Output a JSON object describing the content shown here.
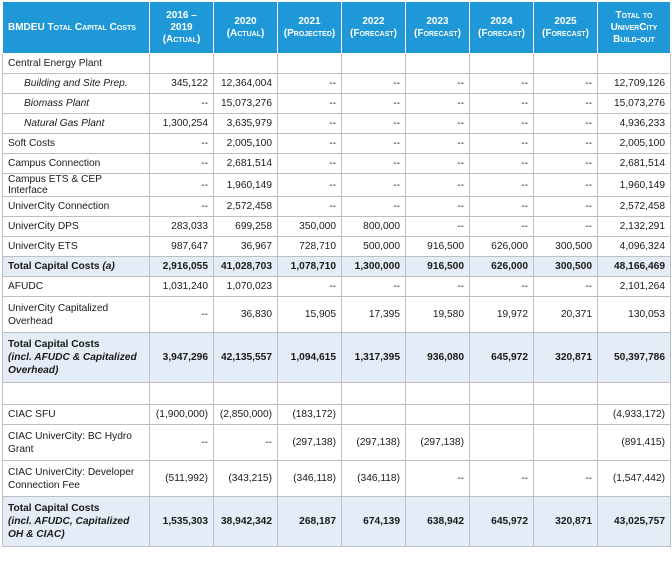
{
  "header": {
    "title": "BMDEU Total Capital Costs",
    "columns": [
      {
        "line1": "2016 –",
        "line2": "2019",
        "line3": "(Actual)"
      },
      {
        "line1": "2020",
        "line2": "(Actual)",
        "line3": ""
      },
      {
        "line1": "2021",
        "line2": "(Projected)",
        "line3": ""
      },
      {
        "line1": "2022",
        "line2": "(Forecast)",
        "line3": ""
      },
      {
        "line1": "2023",
        "line2": "(Forecast)",
        "line3": ""
      },
      {
        "line1": "2024",
        "line2": "(Forecast)",
        "line3": ""
      },
      {
        "line1": "2025",
        "line2": "(Forecast)",
        "line3": ""
      },
      {
        "line1": "Total to",
        "line2": "UniverCity",
        "line3": "Build-out"
      }
    ]
  },
  "rows": [
    {
      "label": "Central Energy Plant",
      "values": [
        "",
        "",
        "",
        "",
        "",
        "",
        "",
        ""
      ]
    },
    {
      "label": "Building and Site Prep.",
      "values": [
        "345,122",
        "12,364,004",
        "--",
        "--",
        "--",
        "--",
        "--",
        "12,709,126"
      ]
    },
    {
      "label": "Biomass Plant",
      "values": [
        "--",
        "15,073,276",
        "--",
        "--",
        "--",
        "--",
        "--",
        "15,073,276"
      ]
    },
    {
      "label": "Natural Gas Plant",
      "values": [
        "1,300,254",
        "3,635,979",
        "--",
        "--",
        "--",
        "--",
        "--",
        "4,936,233"
      ]
    },
    {
      "label": "Soft Costs",
      "values": [
        "--",
        "2,005,100",
        "--",
        "--",
        "--",
        "--",
        "--",
        "2,005,100"
      ]
    },
    {
      "label": "Campus Connection",
      "values": [
        "--",
        "2,681,514",
        "--",
        "--",
        "--",
        "--",
        "--",
        "2,681,514"
      ]
    },
    {
      "label": "Campus ETS & CEP Interface",
      "values": [
        "--",
        "1,960,149",
        "--",
        "--",
        "--",
        "--",
        "--",
        "1,960,149"
      ]
    },
    {
      "label": "UniverCity Connection",
      "values": [
        "--",
        "2,572,458",
        "--",
        "--",
        "--",
        "--",
        "--",
        "2,572,458"
      ]
    },
    {
      "label": "UniverCity DPS",
      "values": [
        "283,033",
        "699,258",
        "350,000",
        "800,000",
        "--",
        "--",
        "--",
        "2,132,291"
      ]
    },
    {
      "label": "UniverCity ETS",
      "values": [
        "987,647",
        "36,967",
        "728,710",
        "500,000",
        "916,500",
        "626,000",
        "300,500",
        "4,096,324"
      ]
    },
    {
      "label": "Total Capital Costs",
      "note": "(a)",
      "values": [
        "2,916,055",
        "41,028,703",
        "1,078,710",
        "1,300,000",
        "916,500",
        "626,000",
        "300,500",
        "48,166,469"
      ]
    },
    {
      "label": "AFUDC",
      "values": [
        "1,031,240",
        "1,070,023",
        "--",
        "--",
        "--",
        "--",
        "--",
        "2,101,264"
      ]
    },
    {
      "label": "UniverCity Capitalized Overhead",
      "values": [
        "--",
        "36,830",
        "15,905",
        "17,395",
        "19,580",
        "19,972",
        "20,371",
        "130,053"
      ]
    },
    {
      "label": "Total Capital Costs",
      "note": "(incl. AFUDC & Capitalized Overhead)",
      "values": [
        "3,947,296",
        "42,135,557",
        "1,094,615",
        "1,317,395",
        "936,080",
        "645,972",
        "320,871",
        "50,397,786"
      ]
    },
    {
      "label": "CIAC SFU",
      "values": [
        "(1,900,000)",
        "(2,850,000)",
        "(183,172)",
        "",
        "",
        "",
        "",
        "(4,933,172)"
      ]
    },
    {
      "label": "CIAC UniverCity: BC Hydro Grant",
      "values": [
        "--",
        "--",
        "(297,138)",
        "(297,138)",
        "(297,138)",
        "",
        "",
        "(891,415)"
      ]
    },
    {
      "label": "CIAC UniverCity: Developer Connection Fee",
      "values": [
        "(511,992)",
        "(343,215)",
        "(346,118)",
        "(346,118)",
        "--",
        "--",
        "--",
        "(1,547,442)"
      ]
    },
    {
      "label": "Total Capital Costs",
      "note": "(incl. AFUDC, Capitalized OH & CIAC)",
      "values": [
        "1,535,303",
        "38,942,342",
        "268,187",
        "674,139",
        "638,942",
        "645,972",
        "320,871",
        "43,025,757"
      ]
    }
  ]
}
